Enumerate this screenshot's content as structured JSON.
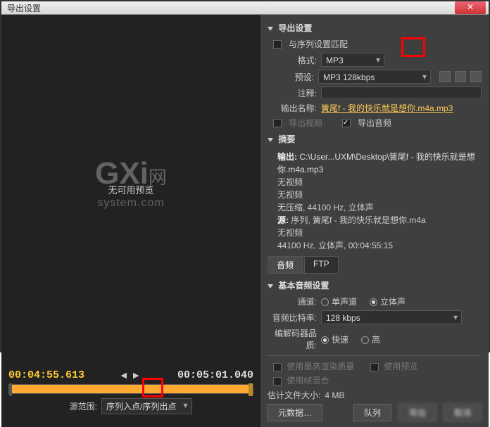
{
  "window": {
    "title": "导出设置"
  },
  "preview": {
    "no_preview": "无可用预览"
  },
  "watermark": {
    "big": "GXi",
    "suffix": "网",
    "sub": "system.com"
  },
  "timeline": {
    "in_tc": "00:04:55.613",
    "out_tc": "00:05:01.040",
    "range_label": "源范围:",
    "range_value": "序列入点/序列出点"
  },
  "export": {
    "header": "导出设置",
    "match_sequence": "与序列设置匹配",
    "format_label": "格式:",
    "format_value": "MP3",
    "preset_label": "预设:",
    "preset_value": "MP3 128kbps",
    "comments_label": "注释:",
    "output_name_label": "输出名称:",
    "output_name_value": "簧尾f - 我的快乐就是想你.m4a.mp3",
    "export_video": "导出视频",
    "export_audio": "导出音频"
  },
  "summary": {
    "header": "摘要",
    "output_tag": "输出:",
    "output_path": "C:\\User...UXM\\Desktop\\簧尾f - 我的快乐就是想你.m4a.mp3",
    "out_line1": "无视频",
    "out_line2": "无视频",
    "out_line3": "无压缩, 44100 Hz, 立体声",
    "source_tag": "源:",
    "source_name": "序列, 簧尾f - 我的快乐就是想你.m4a",
    "src_line1": "无视频",
    "src_line2": "44100 Hz, 立体声, 00:04:55:15"
  },
  "tabs": {
    "audio": "音频",
    "ftp": "FTP"
  },
  "audio": {
    "header": "基本音频设置",
    "channels_label": "通道:",
    "mono": "单声道",
    "stereo": "立体声",
    "bitrate_label": "音频比特率:",
    "bitrate_value": "128 kbps",
    "quality_label": "编解码器品质:",
    "fast": "快速",
    "high": "高"
  },
  "options": {
    "max_render": "使用最高渲染质量",
    "use_preview": "使用预览",
    "frame_blend": "使用帧混合"
  },
  "footer": {
    "est_size_label": "估计文件大小:",
    "est_size_value": "4 MB",
    "metadata_btn": "元数据…",
    "queue_btn": "队列",
    "export_btn": "导出",
    "cancel_btn": "取消"
  }
}
